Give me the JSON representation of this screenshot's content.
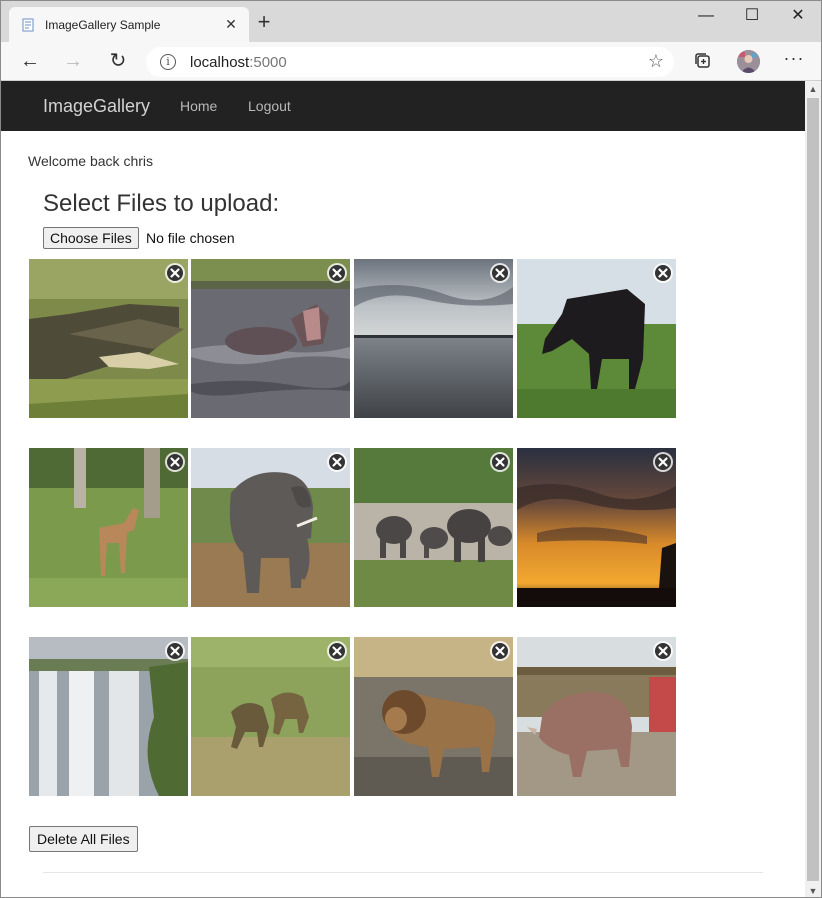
{
  "browser": {
    "tab_title": "ImageGallery Sample",
    "tab_close": "✕",
    "new_tab": "+",
    "minimize": "—",
    "maximize": "☐",
    "close": "✕",
    "back": "←",
    "forward": "→",
    "refresh": "↻",
    "info": "i",
    "url_host": "localhost",
    "url_port": ":5000",
    "favorite": "☆",
    "more": "···"
  },
  "navbar": {
    "brand": "ImageGallery",
    "links": [
      {
        "label": "Home"
      },
      {
        "label": "Logout"
      }
    ]
  },
  "page": {
    "welcome": "Welcome back chris",
    "upload_heading": "Select Files to upload:",
    "choose_files_label": "Choose Files",
    "file_status": "No file chosen",
    "delete_all_label": "Delete All Files"
  },
  "gallery": {
    "images": [
      {
        "subject": "crocodile"
      },
      {
        "subject": "hippo"
      },
      {
        "subject": "river-sky"
      },
      {
        "subject": "wildebeest"
      },
      {
        "subject": "impala"
      },
      {
        "subject": "elephant"
      },
      {
        "subject": "elephant-herd"
      },
      {
        "subject": "sunset"
      },
      {
        "subject": "waterfall"
      },
      {
        "subject": "baboons"
      },
      {
        "subject": "lion"
      },
      {
        "subject": "rhino"
      }
    ]
  },
  "colors": {
    "navbar_bg": "#222222",
    "brand": "#d2d2d2",
    "nav_link": "#b8b8b8"
  }
}
